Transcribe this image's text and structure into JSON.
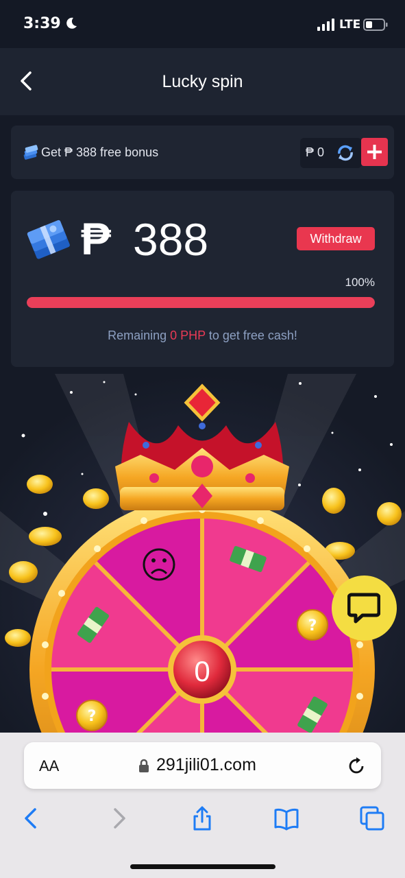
{
  "status_bar": {
    "time": "3:39",
    "network": "LTE",
    "icons": [
      "moon-icon",
      "signal-icon",
      "battery-icon"
    ]
  },
  "header": {
    "title": "Lucky spin",
    "back_icon": "chevron-left-icon"
  },
  "bonus_bar": {
    "text": "Get ₱ 388 free bonus",
    "balance": "₱ 0",
    "icons": [
      "cash-stack-icon",
      "refresh-icon",
      "plus-icon"
    ]
  },
  "cash_card": {
    "currency": "₱",
    "amount": "388",
    "withdraw_label": "Withdraw",
    "progress_label": "100%",
    "progress_value": 1.0,
    "remaining_prefix": "Remaining ",
    "remaining_amount": "0 PHP",
    "remaining_suffix": " to get free cash!"
  },
  "wheel": {
    "center_value": "0",
    "segments": [
      "sad-face-icon",
      "money-icon",
      "mystery-coin-icon",
      "money-icon",
      "mystery-coin-icon",
      "money-icon"
    ]
  },
  "browser": {
    "text_size_label": "AA",
    "url": "291jili01.com",
    "toolbar_icons": [
      "back-icon",
      "forward-icon",
      "share-icon",
      "bookmarks-icon",
      "tabs-icon"
    ]
  },
  "colors": {
    "accent": "#e9374f",
    "background": "#151a26",
    "card": "#1f2532",
    "chat_button": "#f4dd42"
  }
}
